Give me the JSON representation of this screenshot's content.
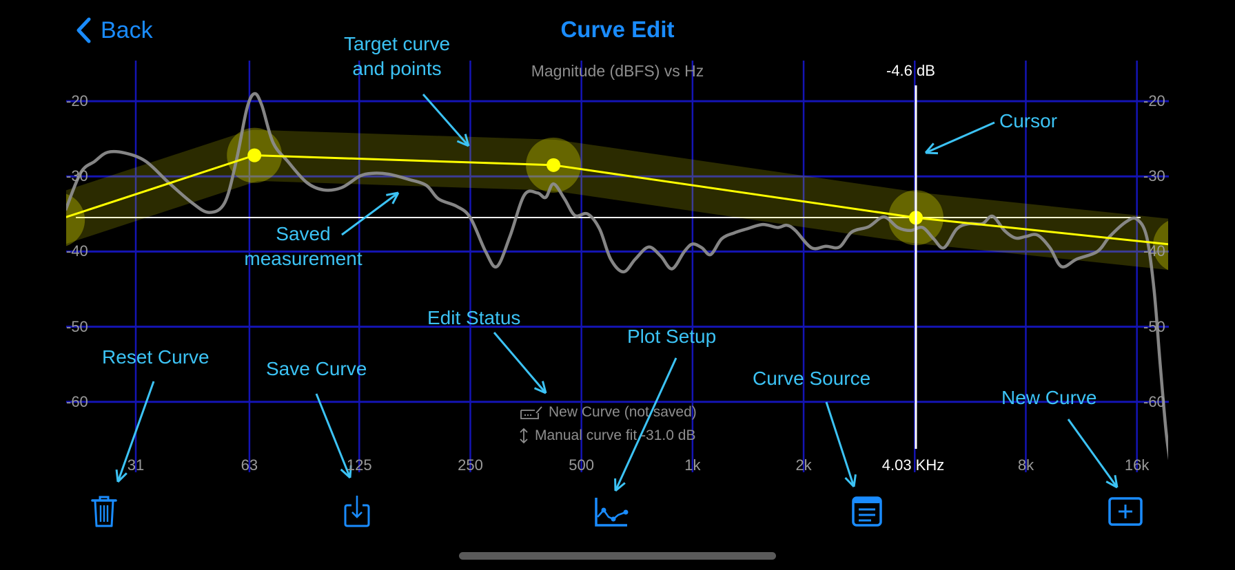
{
  "nav": {
    "back_label": "Back",
    "title": "Curve Edit"
  },
  "plot": {
    "title": "Magnitude (dBFS) vs Hz",
    "cursor_db": "-4.6 dB",
    "cursor_freq": "4.03 KHz"
  },
  "status": {
    "curve_name": "New Curve (not saved)",
    "fit": "Manual curve fit -31.0 dB"
  },
  "annotations": {
    "target": "Target curve\nand points",
    "saved": "Saved\nmeasurement",
    "cursor": "Cursor",
    "edit_status": "Edit Status",
    "reset": "Reset Curve",
    "save": "Save Curve",
    "plot_setup": "Plot Setup",
    "curve_source": "Curve Source",
    "new_curve": "New Curve"
  },
  "toolbar": [
    {
      "id": "reset",
      "icon": "trash-icon"
    },
    {
      "id": "save",
      "icon": "save-download-icon"
    },
    {
      "id": "plot_setup",
      "icon": "chart-icon"
    },
    {
      "id": "curve_source",
      "icon": "document-list-icon"
    },
    {
      "id": "new_curve",
      "icon": "plus-square-icon"
    }
  ],
  "colors": {
    "accent": "#1a8cff",
    "annotation": "#3cc3f5",
    "grid": "#1414b4",
    "target": "#ffff00",
    "measurement": "#8c8c8c"
  },
  "chart_data": {
    "type": "line",
    "title": "Magnitude (dBFS) vs Hz",
    "xlabel": "Hz",
    "ylabel": "Magnitude (dBFS)",
    "x_scale": "log2",
    "x_ticks": [
      31,
      63,
      125,
      250,
      500,
      1000,
      2000,
      4000,
      8000,
      16000
    ],
    "x_tick_labels": [
      "31",
      "63",
      "125",
      "250",
      "500",
      "1k",
      "2k",
      "",
      "8k",
      "16k"
    ],
    "y_ticks": [
      -20,
      -30,
      -40,
      -50,
      -60
    ],
    "y_tick_labels": [
      "-20",
      "-30",
      "-40",
      "-50",
      "-60"
    ],
    "xlim": [
      19,
      21000
    ],
    "ylim": [
      -68,
      -15
    ],
    "grid": true,
    "reference_level_db": -35.5,
    "cursor": {
      "freq_hz": 4030,
      "label_db": "-4.6 dB",
      "label_freq": "4.03 KHz"
    },
    "series": [
      {
        "name": "Target curve",
        "points": [
          [
            19,
            -35.8
          ],
          [
            65,
            -27.2
          ],
          [
            420,
            -28.5
          ],
          [
            4030,
            -35.5
          ],
          [
            21000,
            -39.2
          ]
        ]
      },
      {
        "name": "Saved measurement",
        "points": [
          [
            20,
            -34.5
          ],
          [
            22,
            -29.5
          ],
          [
            24,
            -28
          ],
          [
            26,
            -26.8
          ],
          [
            29,
            -26.9
          ],
          [
            33,
            -28
          ],
          [
            38,
            -30.8
          ],
          [
            44,
            -33.5
          ],
          [
            49,
            -34.8
          ],
          [
            54,
            -33.5
          ],
          [
            58,
            -28
          ],
          [
            62,
            -21
          ],
          [
            65,
            -19
          ],
          [
            68,
            -20.5
          ],
          [
            73,
            -25.5
          ],
          [
            80,
            -28
          ],
          [
            90,
            -30.8
          ],
          [
            100,
            -31.8
          ],
          [
            112,
            -31.5
          ],
          [
            125,
            -30
          ],
          [
            135,
            -29.6
          ],
          [
            150,
            -29.7
          ],
          [
            170,
            -30.4
          ],
          [
            190,
            -31.2
          ],
          [
            205,
            -33
          ],
          [
            230,
            -34
          ],
          [
            250,
            -35.5
          ],
          [
            275,
            -40
          ],
          [
            295,
            -42
          ],
          [
            320,
            -38
          ],
          [
            350,
            -32.5
          ],
          [
            380,
            -32.2
          ],
          [
            400,
            -32.8
          ],
          [
            420,
            -31
          ],
          [
            450,
            -33
          ],
          [
            480,
            -35.2
          ],
          [
            520,
            -35
          ],
          [
            560,
            -37
          ],
          [
            600,
            -41
          ],
          [
            650,
            -42.7
          ],
          [
            700,
            -41
          ],
          [
            760,
            -39.4
          ],
          [
            820,
            -40.6
          ],
          [
            880,
            -42.3
          ],
          [
            950,
            -40
          ],
          [
            1000,
            -39
          ],
          [
            1060,
            -39.5
          ],
          [
            1120,
            -40.4
          ],
          [
            1200,
            -38.3
          ],
          [
            1300,
            -37.5
          ],
          [
            1400,
            -37
          ],
          [
            1550,
            -36.4
          ],
          [
            1700,
            -36.8
          ],
          [
            1800,
            -36.5
          ],
          [
            1900,
            -37.2
          ],
          [
            2100,
            -39.5
          ],
          [
            2300,
            -39.3
          ],
          [
            2500,
            -39.4
          ],
          [
            2700,
            -37.4
          ],
          [
            3000,
            -36.7
          ],
          [
            3300,
            -35.4
          ],
          [
            3600,
            -36.8
          ],
          [
            3900,
            -37.2
          ],
          [
            4200,
            -36.8
          ],
          [
            4500,
            -38.3
          ],
          [
            4800,
            -39.5
          ],
          [
            5200,
            -37
          ],
          [
            5600,
            -36.3
          ],
          [
            6100,
            -36.3
          ],
          [
            6500,
            -35.3
          ],
          [
            7000,
            -37.2
          ],
          [
            7500,
            -38.2
          ],
          [
            8000,
            -38
          ],
          [
            8600,
            -37.8
          ],
          [
            9300,
            -39.5
          ],
          [
            10000,
            -42
          ],
          [
            11000,
            -41
          ],
          [
            12500,
            -40
          ],
          [
            13500,
            -38
          ],
          [
            15000,
            -36
          ],
          [
            16000,
            -35.7
          ],
          [
            17000,
            -38
          ],
          [
            17800,
            -45
          ],
          [
            18500,
            -55
          ],
          [
            19200,
            -64
          ],
          [
            19800,
            -69
          ]
        ]
      }
    ]
  }
}
